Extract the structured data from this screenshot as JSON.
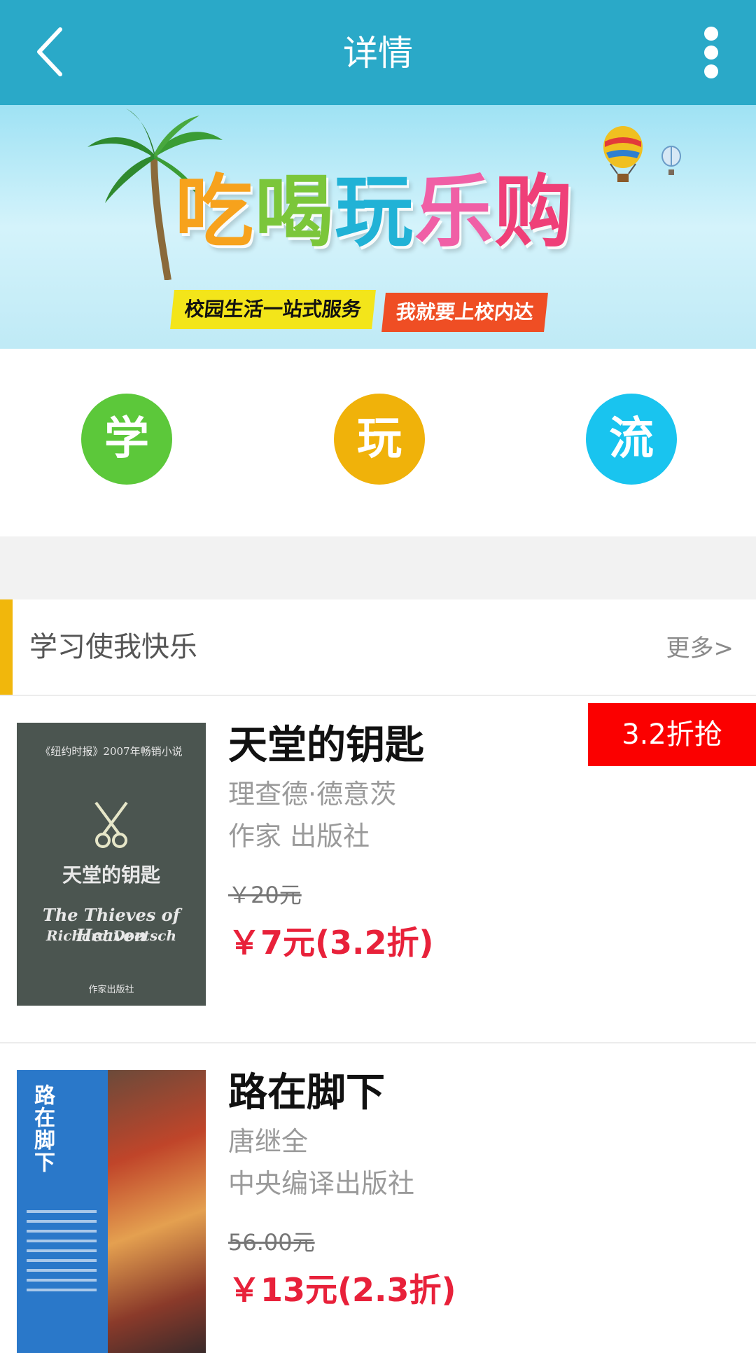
{
  "header": {
    "title": "详情",
    "back_icon": "chevron-left-icon",
    "more_icon": "more-vertical-icon"
  },
  "banner": {
    "main_text": [
      "吃",
      "喝",
      "玩",
      "乐",
      "购"
    ],
    "slogan_left": "校园生活一站式服务",
    "slogan_right": "我就要上校内达"
  },
  "categories": [
    {
      "label": "学",
      "color": "#5cc83a"
    },
    {
      "label": "玩",
      "color": "#f0b20a"
    },
    {
      "label": "流",
      "color": "#19c4ef"
    }
  ],
  "section": {
    "title": "学习使我快乐",
    "more": "更多>",
    "accent": "#f1b70c"
  },
  "books": [
    {
      "title": "天堂的钥匙",
      "author": "理查德·德意茨",
      "publisher": "作家 出版社",
      "original_price": "￥20元",
      "price": "￥7元(3.2折)",
      "badge": "3.2折抢",
      "cover": {
        "top": "《纽约时报》2007年畅销小说",
        "cn_title": "天堂的钥匙",
        "en_title": "The Thieves of Heaven",
        "en_author": "Richard Doetsch",
        "publisher": "作家出版社"
      }
    },
    {
      "title": "路在脚下",
      "author": "唐继全",
      "publisher": "中央编译出版社",
      "original_price": "56.00元",
      "price": "￥13元(2.3折)",
      "cover": {
        "cn_title": "路在脚下"
      }
    }
  ],
  "colors": {
    "topbar": "#2aa9c8",
    "price_red": "#e8213a",
    "badge_red": "#fb0000"
  }
}
